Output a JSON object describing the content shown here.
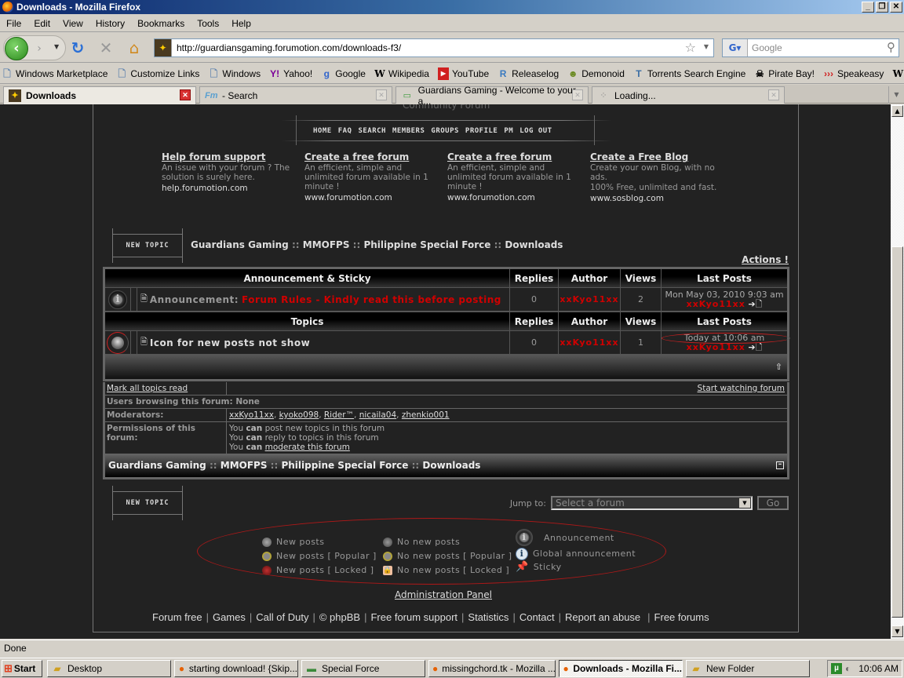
{
  "window": {
    "title": "Downloads - Mozilla Firefox",
    "controls": [
      "minimize",
      "restore",
      "close"
    ]
  },
  "menu": [
    "File",
    "Edit",
    "View",
    "History",
    "Bookmarks",
    "Tools",
    "Help"
  ],
  "nav": {
    "url": "http://guardiansgaming.forumotion.com/downloads-f3/",
    "search_placeholder": "Google"
  },
  "bookmarks": [
    {
      "label": "Windows Marketplace",
      "icon": "page-icon"
    },
    {
      "label": "Customize Links",
      "icon": "page-icon"
    },
    {
      "label": "Windows",
      "icon": "page-icon"
    },
    {
      "label": "Yahoo!",
      "icon": "yahoo-icon"
    },
    {
      "label": "Google",
      "icon": "google-icon"
    },
    {
      "label": "Wikipedia",
      "icon": "wikipedia-icon"
    },
    {
      "label": "YouTube",
      "icon": "youtube-icon"
    },
    {
      "label": "Releaselog",
      "icon": "releaselog-icon"
    },
    {
      "label": "Demonoid",
      "icon": "demonoid-icon"
    },
    {
      "label": "Torrents Search Engine",
      "icon": "torrentz-icon"
    },
    {
      "label": "Pirate Bay!",
      "icon": "piratebay-icon"
    },
    {
      "label": "Speakeasy",
      "icon": "speakeasy-icon"
    },
    {
      "label": "Wiktionary",
      "icon": "wiktionary-icon"
    }
  ],
  "tabs": [
    {
      "label": "Downloads",
      "active": true
    },
    {
      "label": "- Search",
      "active": false
    },
    {
      "label": "Guardians Gaming - Welcome to your a...",
      "active": false
    },
    {
      "label": "Loading...",
      "active": false
    }
  ],
  "page": {
    "community_label": "Community Forum",
    "navmenu": [
      "HOME",
      "FAQ",
      "SEARCH",
      "MEMBERS",
      "GROUPS",
      "PROFILE",
      "PM",
      "LOG OUT"
    ],
    "promos": [
      {
        "title": "Help forum support",
        "desc": "An issue with your forum ? The solution is surely here.",
        "url": "help.forumotion.com"
      },
      {
        "title": "Create a free forum",
        "desc": "An efficient, simple and unlimited forum available in 1 minute !",
        "url": "www.forumotion.com"
      },
      {
        "title": "Create a free forum",
        "desc": "An efficient, simple and unlimited forum available in 1 minute !",
        "url": "www.forumotion.com"
      },
      {
        "title": "Create a Free Blog",
        "desc": "Create your own Blog, with no ads.",
        "desc2": "100% Free, unlimited and fast.",
        "url": "www.sosblog.com"
      }
    ],
    "new_topic_label": "NEW TOPIC",
    "breadcrumb": {
      "parts": [
        "Guardians Gaming",
        "MMOFPS",
        "Philippine Special Force",
        "Downloads"
      ],
      "sep": "::"
    },
    "actions_label": "Actions !",
    "table": {
      "announce_header": "Announcement & Sticky",
      "topics_header": "Topics",
      "columns": [
        "Replies",
        "Author",
        "Views",
        "Last Posts"
      ],
      "announcement": {
        "prefix": "Announcement:",
        "title": "Forum Rules - Kindly read this before posting",
        "replies": "0",
        "author": "xxKyo11xx",
        "views": "2",
        "last_date": "Mon May 03, 2010 9:03 am",
        "last_author": "xxKyo11xx"
      },
      "topics": [
        {
          "title": "Icon for new posts not show",
          "replies": "0",
          "author": "xxKyo11xx",
          "views": "1",
          "last_date": "Today at 10:06 am",
          "last_author": "xxKyo11xx"
        }
      ]
    },
    "info": {
      "mark_read": "Mark all topics read",
      "watch": "Start watching forum",
      "browsing_label": "Users browsing this forum:",
      "browsing_value": "None",
      "moderators_label": "Moderators:",
      "moderators": [
        "xxKyo11xx",
        "kyoko098",
        "Rider™",
        "nicaila04",
        "zhenkio001"
      ],
      "permissions_label": "Permissions of this forum:",
      "permissions": [
        {
          "pre": "You",
          "can": "can",
          "post": "post new topics in this forum",
          "link": false
        },
        {
          "pre": "You",
          "can": "can",
          "post": "reply to topics in this forum",
          "link": false
        },
        {
          "pre": "You",
          "can": "can",
          "post": "moderate this forum",
          "link": true
        }
      ]
    },
    "jump": {
      "label": "Jump to:",
      "selected": "Select a forum",
      "go": "Go"
    },
    "legend": {
      "col1": [
        "New posts",
        "New posts [ Popular ]",
        "New posts [ Locked ]"
      ],
      "col2": [
        "No new posts",
        "No new posts [ Popular ]",
        "No new posts [ Locked ]"
      ],
      "col3": [
        "Announcement",
        "Global announcement",
        "Sticky"
      ]
    },
    "admin_panel": "Administration Panel",
    "footer_links": [
      "Forum free",
      "Games",
      "Call of Duty",
      "© phpBB",
      "Free forum support",
      "Statistics",
      "Contact",
      "Report an abuse",
      "Free forums"
    ]
  },
  "status": "Done",
  "taskbar": {
    "start": "Start",
    "tasks": [
      {
        "label": "Desktop",
        "icon": "folder-icon",
        "active": false
      },
      {
        "label": "starting download! {Skip...",
        "icon": "firefox-icon",
        "active": false
      },
      {
        "label": "Special Force",
        "icon": "game-icon",
        "active": false
      },
      {
        "label": "missingchord.tk - Mozilla ...",
        "icon": "firefox-icon",
        "active": false
      },
      {
        "label": "Downloads - Mozilla Fi...",
        "icon": "firefox-icon",
        "active": true
      },
      {
        "label": "New Folder",
        "icon": "folder-icon",
        "active": false
      }
    ],
    "clock": "10:06 AM"
  }
}
